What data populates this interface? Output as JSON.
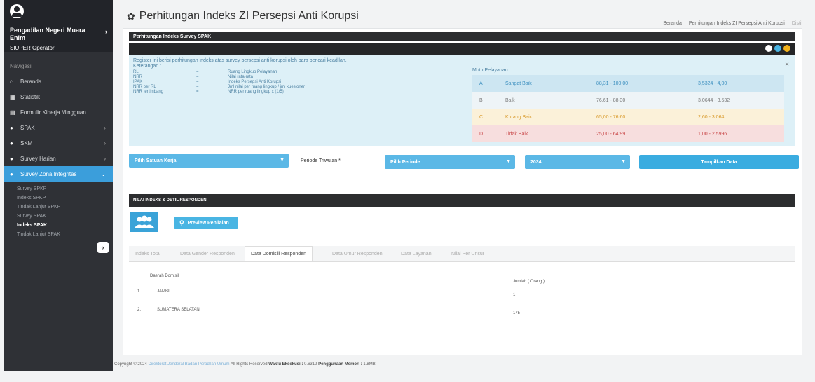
{
  "sidebar": {
    "unit": "Pengadilan Negeri Muara Enim",
    "role": "SIUPER Operator",
    "section": "Navigasi",
    "items": [
      {
        "label": "Beranda",
        "icon": "home-icon"
      },
      {
        "label": "Statistik",
        "icon": "chart-icon"
      },
      {
        "label": "Formulir Kinerja Mingguan",
        "icon": "document-icon"
      },
      {
        "label": "SPAK",
        "icon": "dot-icon"
      },
      {
        "label": "SKM",
        "icon": "dot-icon"
      },
      {
        "label": "Survey Harian",
        "icon": "dot-icon"
      },
      {
        "label": "Survey Zona Integritas",
        "icon": "dot-icon"
      }
    ],
    "subitems": [
      "Survey SPKP",
      "Indeks SPKP",
      "Tindak Lanjut SPKP",
      "Survey SPAK",
      "Indeks SPAK",
      "Tindak Lanjut SPAK"
    ],
    "collapse": "«"
  },
  "header": {
    "title": "Perhitungan Indeks ZI Persepsi Anti Korupsi",
    "breadcrumb": [
      "Beranda",
      "Perhitungan Indeks ZI Persepsi Anti Korupsi",
      "Distil"
    ]
  },
  "panel": {
    "title": "Perhitungan Indeks Survey SPAK",
    "intro": "Register ini berisi perhitungan indeks atas survey persepsi anti korupsi oleh para pencari keadilan.",
    "keterangan": "Keterangan :",
    "legend": [
      {
        "k": "RL",
        "v": "Ruang Lingkup Pelayanan"
      },
      {
        "k": "NRR",
        "v": "Nilai rata-rata"
      },
      {
        "k": "IPAK",
        "v": "Indeks Persepsi Anti Korupsi"
      },
      {
        "k": "NRR per RL",
        "v": "Jml nilai per ruang lingkup / jml kuesioner"
      },
      {
        "k": "NRR tertimbang",
        "v": "NRR per ruang lingkup x (1/5)"
      }
    ],
    "mutu_label": "Mutu Pelayanan",
    "mutu": [
      {
        "g": "A",
        "name": "Sangat Baik",
        "range": "88,31 - 100,00",
        "idx": "3,5324 - 4,00"
      },
      {
        "g": "B",
        "name": "Baik",
        "range": "76,61 - 88,30",
        "idx": "3,0644 - 3,532"
      },
      {
        "g": "C",
        "name": "Kurang Baik",
        "range": "65,00 - 76,60",
        "idx": "2,60 - 3,064"
      },
      {
        "g": "D",
        "name": "Tidak Baik",
        "range": "25,00 - 64,99",
        "idx": "1,00 - 2,5996"
      }
    ],
    "close": "×"
  },
  "filters": {
    "satuan_kerja": "Pilih Satuan Kerja",
    "periode_label": "Periode Triwulan *",
    "periode": "Pilih Periode",
    "tahun": "2024",
    "show_button": "Tampilkan Data"
  },
  "nilai": {
    "title": "NILAI INDEKS & DETIL RESPONDEN",
    "preview_button": "Preview Penilaian"
  },
  "tabs": [
    "Indeks Total",
    "Data Gender Responden",
    "Data Domisili Responden",
    "Data Umur Responden",
    "Data Layanan",
    "Nilai Per Unsur"
  ],
  "domisili": {
    "col_daerah": "Daerah Domisili",
    "col_jumlah": "Jumlah ( Orang )",
    "rows": [
      {
        "no": "1.",
        "name": "JAMBI",
        "count": "1"
      },
      {
        "no": "2.",
        "name": "SUMATERA SELATAN",
        "count": "175"
      }
    ]
  },
  "footer": {
    "prefix": "Copyright © 2024",
    "link": "Direktorat Jenderal Badan Peradilan Umum",
    "rights": "All Rights Reserved",
    "exec_label": "Waktu Eksekusi :",
    "exec_value": "0.6312",
    "mem_label": "Penggunaan Memori :",
    "mem_value": "1.8MB"
  },
  "colors": {
    "sidebar": "#2f3136",
    "accent": "#3b9edb",
    "dark_bar": "#2c2d2f"
  }
}
